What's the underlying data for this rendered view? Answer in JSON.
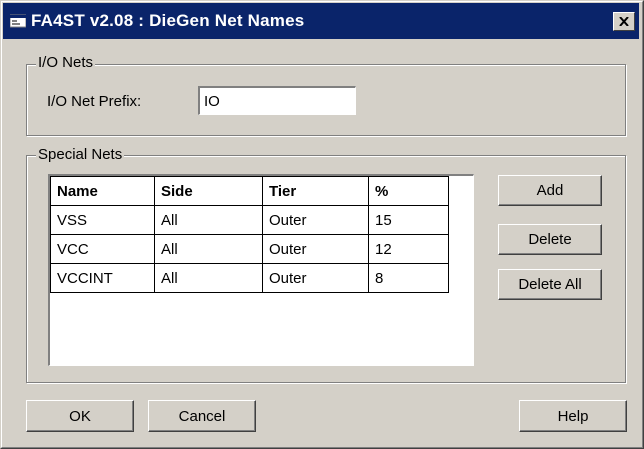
{
  "window": {
    "title": "FA4ST v2.08 : DieGen Net Names"
  },
  "io_nets": {
    "legend": "I/O Nets",
    "prefix_label": "I/O Net Prefix:",
    "prefix_value": "IO"
  },
  "special_nets": {
    "legend": "Special Nets",
    "columns": [
      "Name",
      "Side",
      "Tier",
      "%"
    ],
    "rows": [
      [
        "VSS",
        "All",
        "Outer",
        "15"
      ],
      [
        "VCC",
        "All",
        "Outer",
        "12"
      ],
      [
        "VCCINT",
        "All",
        "Outer",
        "8"
      ]
    ],
    "buttons": {
      "add": "Add",
      "delete": "Delete",
      "delete_all": "Delete All"
    }
  },
  "footer": {
    "ok": "OK",
    "cancel": "Cancel",
    "help": "Help"
  },
  "colors": {
    "titlebar": "#0a246a",
    "face": "#d4d0c8"
  }
}
